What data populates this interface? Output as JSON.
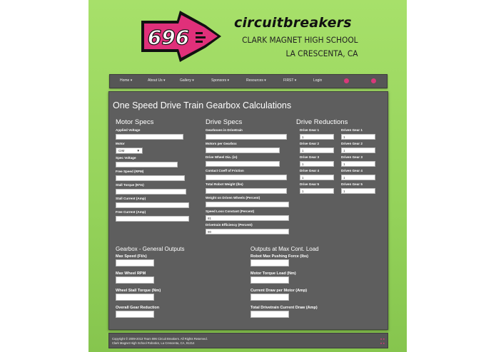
{
  "header": {
    "logo_number": "696",
    "brand": "circuitbreakers",
    "school_line1": "CLARK MAGNET HIGH SCHOOL",
    "school_line2": "LA CRESCENTA, CA",
    "brand_color": "#e0307a"
  },
  "nav": {
    "items": [
      "Home",
      "About Us",
      "Gallery",
      "Sponsors",
      "Resources",
      "FIRST",
      "Login"
    ]
  },
  "main": {
    "title": "One Speed Drive Train Gearbox Calculations",
    "motor": {
      "heading": "Motor Specs",
      "applied_voltage": "Applied Voltage",
      "motor": "Motor",
      "motor_value": "CIM",
      "spec_voltage": "Spec Voltage",
      "free_speed": "Free Speed (RPM)",
      "stall_torque": "Stall Torque (N*m)",
      "stall_current": "Stall Current (Amp)",
      "free_current": "Free Current (Amp)"
    },
    "drive": {
      "heading": "Drive Specs",
      "gearboxes": "Gearboxes in Drivetrain",
      "motors_per_gearbox": "Motors per Gearbox",
      "wheel_dia": "Drive Wheel Dia. (in)",
      "friction": "Contact Coeff of Friction",
      "robot_weight": "Total Robot Weight (lbs)",
      "weight_on_wheels": "Weight on Driven Wheels (Percent)",
      "speed_loss": "Speed Loss Constant (Percent)",
      "speed_loss_value": "81",
      "efficiency": "Drivetrain Efficiency (Percent)",
      "efficiency_value": "90"
    },
    "reductions": {
      "heading": "Drive Reductions",
      "rows": [
        {
          "drive": "Drive Gear 1",
          "driven": "Driven Gear 1",
          "drive_value": "1",
          "driven_value": "1"
        },
        {
          "drive": "Drive Gear 2",
          "driven": "Driven Gear 2",
          "drive_value": "1",
          "driven_value": "1"
        },
        {
          "drive": "Drive Gear 3",
          "driven": "Driven Gear 3",
          "drive_value": "1",
          "driven_value": "1"
        },
        {
          "drive": "Drive Gear 4",
          "driven": "Driven Gear 4",
          "drive_value": "1",
          "driven_value": "1"
        },
        {
          "drive": "Drive Gear 5",
          "driven": "Driven Gear 5",
          "drive_value": "1",
          "driven_value": "1"
        }
      ]
    },
    "general": {
      "heading": "Gearbox - General Outputs",
      "max_speed": "Max Speed (Ft/s)",
      "max_wheel_rpm": "Max Wheel RPM",
      "wheel_stall_torque": "Wheel Stall Torque (Nm)",
      "overall_reduction": "Overall Gear Reduction"
    },
    "maxload": {
      "heading": "Outputs at Max Cont. Load",
      "pushing_force": "Robot Max Pushing Force (lbs)",
      "motor_torque": "Motor Torque Load (Nm)",
      "current_per_motor": "Current Draw per Motor (Amp)",
      "total_current": "Total Drivetrain Current Draw (Amp)"
    }
  },
  "footer": {
    "line1": "Copyright © 2009-2013 Team 696 Circuit Breakers. All Rights Reserved.",
    "line2": "Clark Magnet High School Robotics, La Crescenta, CA, 91214"
  }
}
